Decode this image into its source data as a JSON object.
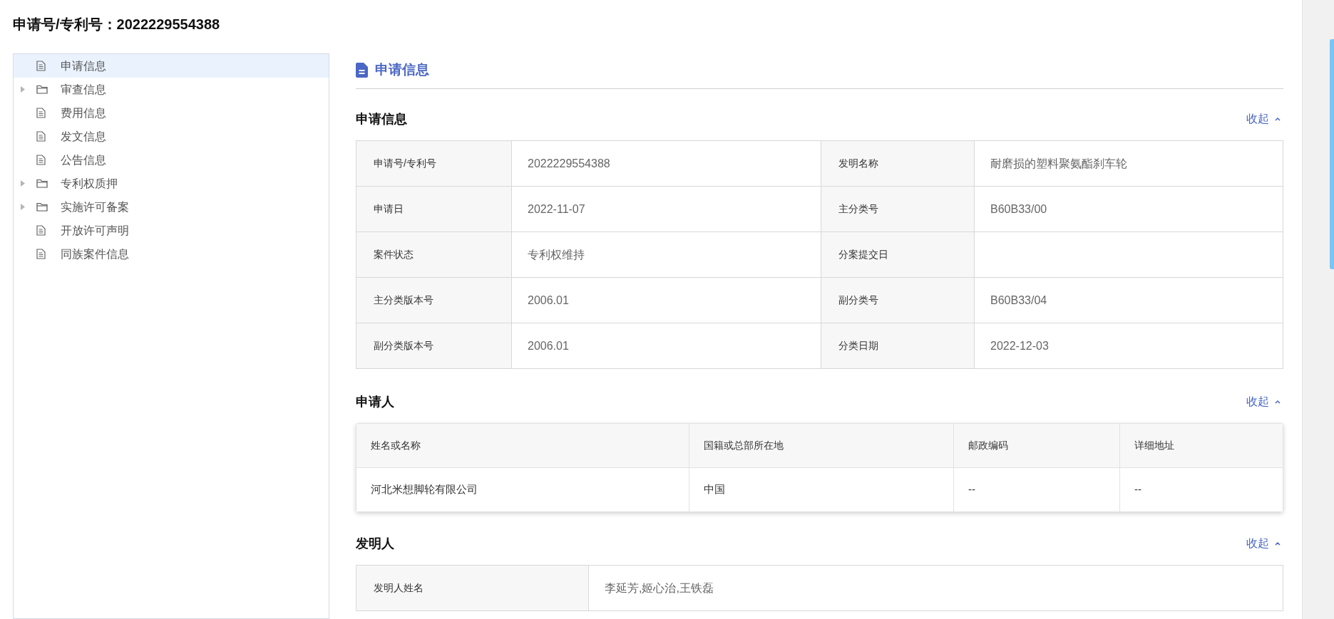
{
  "page_title": "申请号/专利号：2022229554388",
  "sidebar": {
    "items": [
      {
        "label": "申请信息",
        "kind": "file",
        "selected": true
      },
      {
        "label": "审查信息",
        "kind": "folder",
        "selected": false
      },
      {
        "label": "费用信息",
        "kind": "file",
        "selected": false
      },
      {
        "label": "发文信息",
        "kind": "file",
        "selected": false
      },
      {
        "label": "公告信息",
        "kind": "file",
        "selected": false
      },
      {
        "label": "专利权质押",
        "kind": "folder",
        "selected": false
      },
      {
        "label": "实施许可备案",
        "kind": "folder",
        "selected": false
      },
      {
        "label": "开放许可声明",
        "kind": "file",
        "selected": false
      },
      {
        "label": "同族案件信息",
        "kind": "file",
        "selected": false
      }
    ]
  },
  "section_heading": "申请信息",
  "application_info": {
    "title": "申请信息",
    "collapse_label": "收起",
    "fields": [
      {
        "label": "申请号/专利号",
        "value": "2022229554388"
      },
      {
        "label": "发明名称",
        "value": "耐磨损的塑料聚氨酯刹车轮"
      },
      {
        "label": "申请日",
        "value": "2022-11-07"
      },
      {
        "label": "主分类号",
        "value": "B60B33/00"
      },
      {
        "label": "案件状态",
        "value": "专利权维持"
      },
      {
        "label": "分案提交日"
      },
      {
        "label": "主分类版本号",
        "value": "2006.01"
      },
      {
        "label": "副分类号",
        "value": "B60B33/04"
      },
      {
        "label": "副分类版本号",
        "value": "2006.01"
      },
      {
        "label": "分类日期",
        "value": "2022-12-03"
      }
    ]
  },
  "applicants": {
    "title": "申请人",
    "collapse_label": "收起",
    "columns": [
      "姓名或名称",
      "国籍或总部所在地",
      "邮政编码",
      "详细地址"
    ],
    "rows": [
      [
        "河北米想脚轮有限公司",
        "中国",
        "--",
        "--"
      ]
    ]
  },
  "inventors": {
    "title": "发明人",
    "collapse_label": "收起",
    "fields": [
      {
        "label": "发明人姓名",
        "value": "李延芳,姬心治,王铁磊"
      }
    ]
  }
}
